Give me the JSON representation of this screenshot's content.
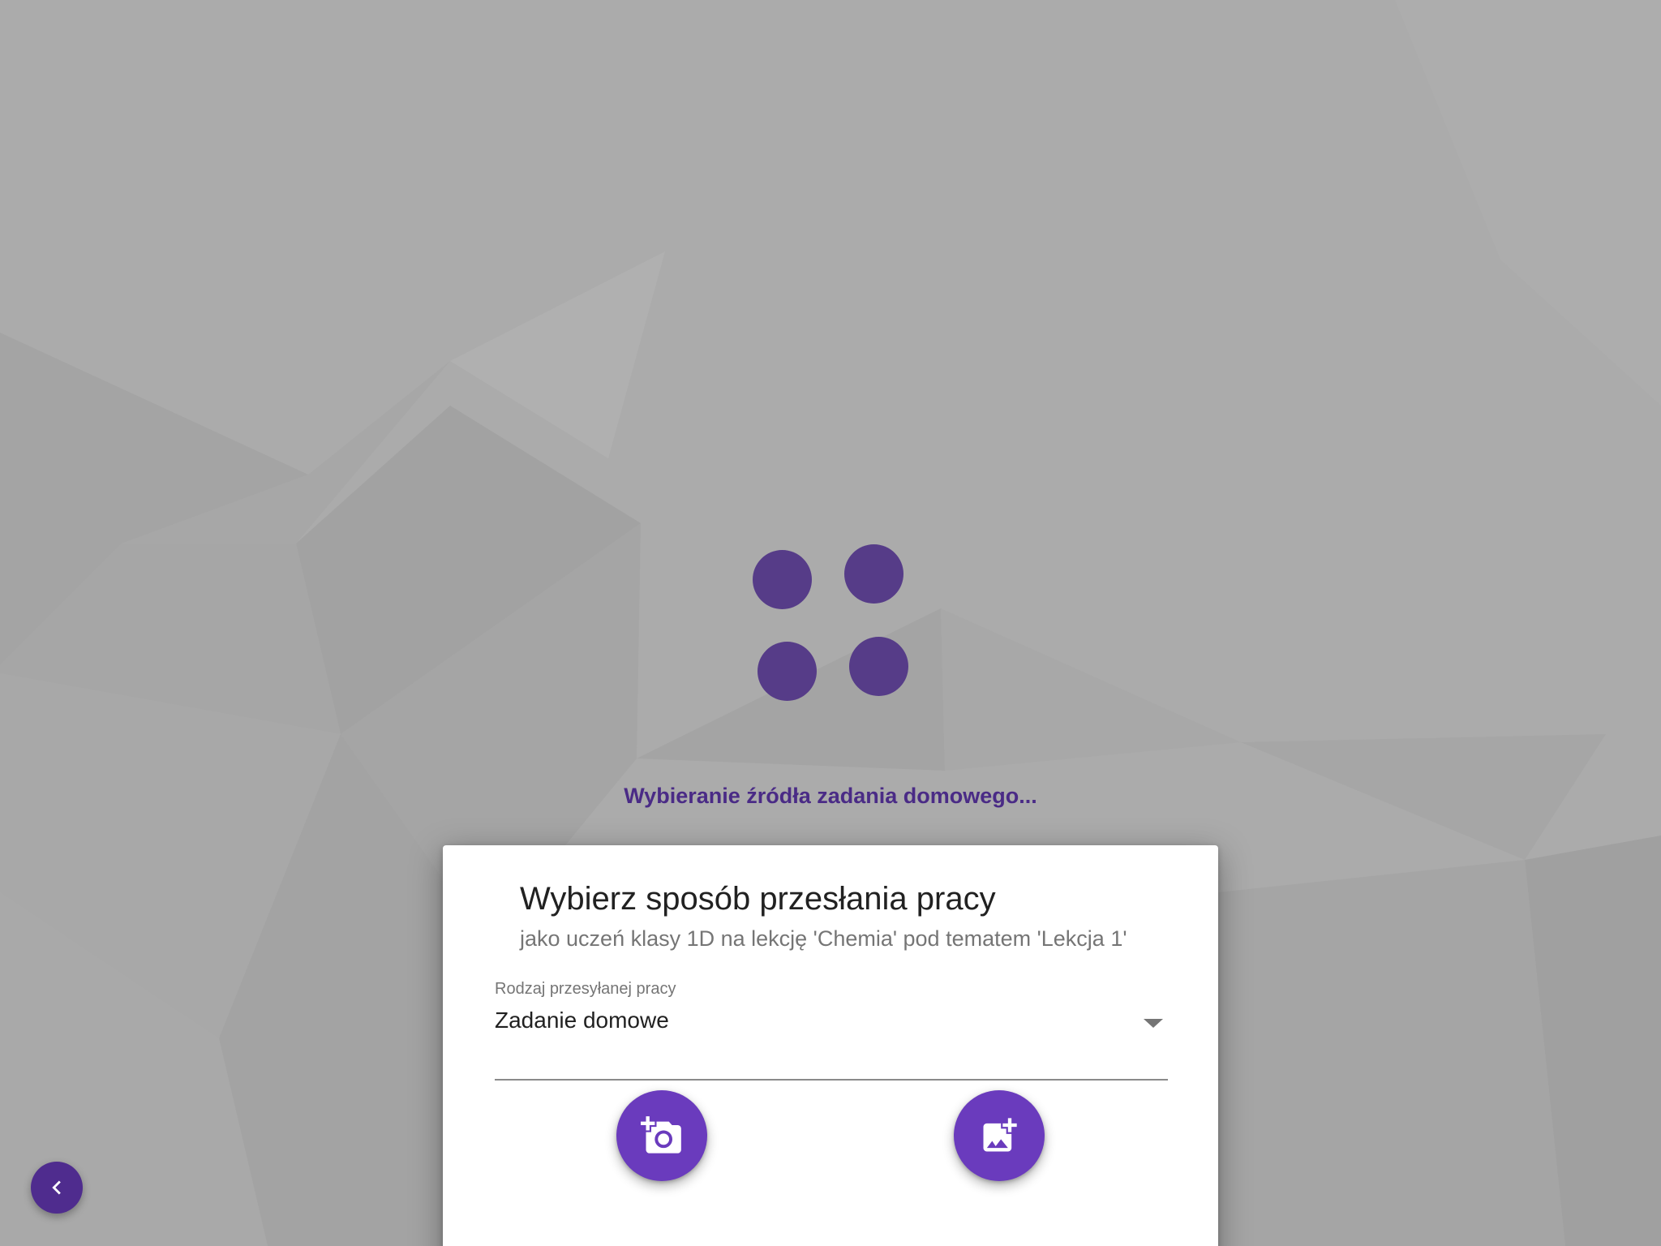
{
  "loading": {
    "text": "Wybieranie źródła zadania domowego..."
  },
  "dialog": {
    "title": "Wybierz sposób przesłania pracy",
    "subtitle": "jako uczeń klasy 1D na lekcję 'Chemia' pod tematem 'Lekcja 1'",
    "select": {
      "label": "Rodzaj przesyłanej pracy",
      "value": "Zadanie domowe"
    },
    "actions": [
      {
        "icon": "add-camera-icon"
      },
      {
        "icon": "add-photo-icon"
      }
    ]
  },
  "back_button": {
    "icon": "chevron-left-icon"
  },
  "colors": {
    "accent": "#6a3bbd",
    "loader_dot": "#563c88",
    "loading_text": "#4a2b86",
    "background": "#a9a9a9"
  }
}
